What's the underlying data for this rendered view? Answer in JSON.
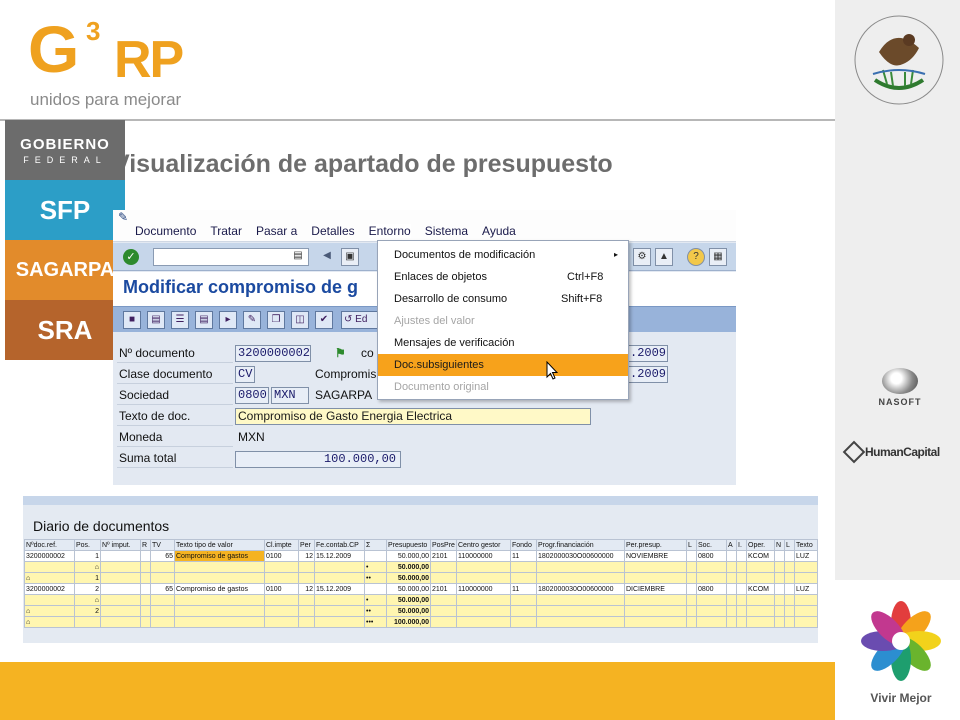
{
  "logo": {
    "g": "G",
    "three": "3",
    "rp": "RP",
    "tagline": "unidos para mejorar"
  },
  "slide_title": "Visualización de apartado de presupuesto",
  "right_column": {
    "seal": "ESTADOS UNIDOS MEXICANOS",
    "gobierno": {
      "line1": "GOBIERNO",
      "line2": "FEDERAL"
    },
    "sfp": "SFP",
    "sagarpa": "SAGARPA",
    "sra": "SRA",
    "nasoft": "NASOFT",
    "humancapital": "HumanCapital",
    "vivir": "Vivir Mejor"
  },
  "sap": {
    "menubar": [
      "Documento",
      "Tratar",
      "Pasar a",
      "Detalles",
      "Entorno",
      "Sistema",
      "Ayuda"
    ],
    "screen_title": "Modificar compromiso de g",
    "form": {
      "labels": [
        "Nº documento",
        "Clase documento",
        "Sociedad",
        "Texto de doc.",
        "Moneda",
        "Suma total"
      ],
      "doc_number": "3200000002",
      "doc_class": "CV",
      "doc_class_text": "Compromis",
      "company": "0800",
      "company_currency": "MXN",
      "company_text": "SAGARPA",
      "co_text": "co",
      "doc_text": "Compromiso de Gasto Energia Electrica",
      "currency": "MXN",
      "total": "100.000,00",
      "date1": ".2009",
      "date2": ".2009",
      "tb2_edit": "Ed"
    },
    "dropdown": [
      {
        "label": "Documentos de modificación",
        "shortcut": "",
        "state": "normal",
        "submenu": true
      },
      {
        "label": "Enlaces de objetos",
        "shortcut": "Ctrl+F8",
        "state": "normal"
      },
      {
        "label": "Desarrollo de consumo",
        "shortcut": "Shift+F8",
        "state": "normal"
      },
      {
        "label": "Ajustes del valor",
        "shortcut": "",
        "state": "disabled"
      },
      {
        "label": "Mensajes de verificación",
        "shortcut": "",
        "state": "normal"
      },
      {
        "label": "Doc.subsiguientes",
        "shortcut": "",
        "state": "selected"
      },
      {
        "label": "Documento original",
        "shortcut": "",
        "state": "disabled"
      }
    ]
  },
  "journal": {
    "title": "Diario de documentos",
    "headers": [
      "Nºdoc.ref.",
      "Pos.",
      "Nº imput.",
      "R",
      "TV",
      "Texto tipo de valor",
      "Cl.impte",
      "Per",
      "Fe.contab.CP",
      "Σ",
      "Presupuesto",
      "PosPre",
      "Centro gestor",
      "Fondo",
      "Progr.financiación",
      "Per.presup.",
      "L",
      "Soc.",
      "A",
      "I.",
      "Oper.",
      "N",
      "L",
      "Texto"
    ],
    "rows": [
      {
        "kind": "data",
        "cells": [
          "3200000002",
          "1",
          "",
          "",
          "65",
          "Compromiso de gastos",
          "0100",
          "12",
          "15.12.2009",
          "",
          "50.000,00",
          "2101",
          "110000000",
          "11",
          "1802000030O00600000",
          "NOVIEMBRE",
          "",
          "0800",
          "",
          "",
          "KCOM",
          "",
          "",
          "LUZ"
        ]
      },
      {
        "kind": "sub",
        "cells": [
          "",
          "⌂",
          "",
          "",
          "",
          "",
          "",
          "",
          "",
          "•",
          "50.000,00",
          "",
          "",
          "",
          "",
          "",
          "",
          "",
          "",
          "",
          "",
          "",
          "",
          ""
        ]
      },
      {
        "kind": "sub",
        "cells": [
          "⌂",
          "1",
          "",
          "",
          "",
          "",
          "",
          "",
          "",
          "••",
          "50.000,00",
          "",
          "",
          "",
          "",
          "",
          "",
          "",
          "",
          "",
          "",
          "",
          "",
          ""
        ]
      },
      {
        "kind": "data",
        "cells": [
          "3200000002",
          "2",
          "",
          "",
          "65",
          "Compromiso de gastos",
          "0100",
          "12",
          "15.12.2009",
          "",
          "50.000,00",
          "2101",
          "110000000",
          "11",
          "1802000030O00600000",
          "DICIEMBRE",
          "",
          "0800",
          "",
          "",
          "KCOM",
          "",
          "",
          "LUZ"
        ]
      },
      {
        "kind": "sub",
        "cells": [
          "",
          "⌂",
          "",
          "",
          "",
          "",
          "",
          "",
          "",
          "•",
          "50.000,00",
          "",
          "",
          "",
          "",
          "",
          "",
          "",
          "",
          "",
          "",
          "",
          "",
          ""
        ]
      },
      {
        "kind": "sub",
        "cells": [
          "⌂",
          "2",
          "",
          "",
          "",
          "",
          "",
          "",
          "",
          "••",
          "50.000,00",
          "",
          "",
          "",
          "",
          "",
          "",
          "",
          "",
          "",
          "",
          "",
          "",
          ""
        ]
      },
      {
        "kind": "sub",
        "cells": [
          "⌂",
          "",
          "",
          "",
          "",
          "",
          "",
          "",
          "",
          "•••",
          "100.000,00",
          "",
          "",
          "",
          "",
          "",
          "",
          "",
          "",
          "",
          "",
          "",
          "",
          ""
        ]
      }
    ]
  },
  "colors": {
    "accent_orange": "#f5b322",
    "sap_title_blue": "#1b4aa0",
    "menu_highlight": "#f7a21b"
  }
}
